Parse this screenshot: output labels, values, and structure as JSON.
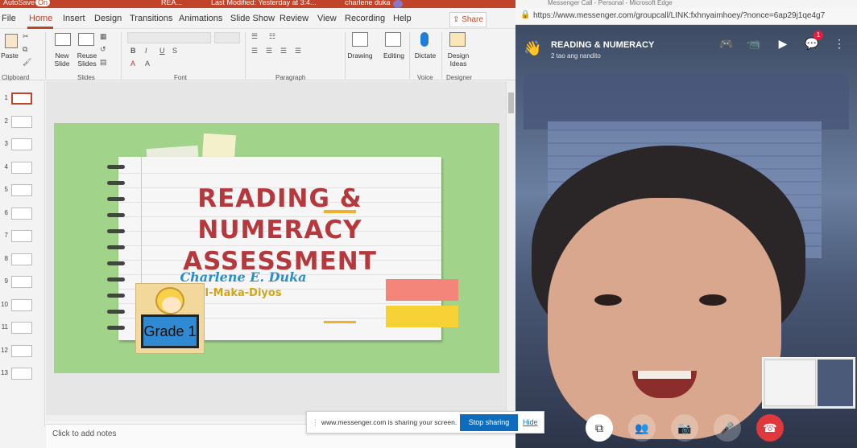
{
  "ppt": {
    "titlebar": {
      "autosave": "AutoSave",
      "autosave_state": "On",
      "docname": "REA...",
      "last_modified": "Last Modified: Yesterday at 3:4...",
      "user": "charlene duka"
    },
    "tabs": [
      "File",
      "Home",
      "Insert",
      "Design",
      "Transitions",
      "Animations",
      "Slide Show",
      "Review",
      "View",
      "Recording",
      "Help"
    ],
    "active_tab": "Home",
    "share_label": "Share",
    "ribbon": {
      "paste": "Paste",
      "new_slide": "New Slide",
      "reuse_slides": "Reuse Slides",
      "drawing": "Drawing",
      "editing": "Editing",
      "dictate": "Dictate",
      "design_ideas": "Design Ideas",
      "groups": {
        "clipboard": "Clipboard",
        "slides": "Slides",
        "font": "Font",
        "paragraph": "Paragraph",
        "voice": "Voice",
        "designer": "Designer"
      }
    },
    "thumbnails": [
      "1",
      "2",
      "3",
      "4",
      "5",
      "6",
      "7",
      "8",
      "9",
      "10",
      "11",
      "12",
      "13"
    ],
    "notes_placeholder": "Click to add notes",
    "slide": {
      "title_line1": "READING &",
      "title_line2": "NUMERACY",
      "title_line3": "ASSESSMENT",
      "name": "Charlene E. Duka",
      "school": "I-Maka-Diyos",
      "grade": "Grade 1"
    }
  },
  "edge": {
    "title": "Messenger Call - Personal - Microsoft Edge",
    "url": "https://www.messenger.com/groupcall/LINK:fxhnyaimhoey/?nonce=6ap29j1qe4g7"
  },
  "call": {
    "title": "READING & NUMERACY",
    "subtitle": "2 tao ang nandito",
    "chat_badge": "1"
  },
  "share_notice": {
    "text": "www.messenger.com is sharing your screen.",
    "stop": "Stop sharing",
    "hide": "Hide"
  },
  "colors": {
    "ppt_accent": "#c0432a",
    "slide_bg": "#a2d38a",
    "end_call": "#e0393d",
    "stop_btn": "#0f6cbd"
  }
}
